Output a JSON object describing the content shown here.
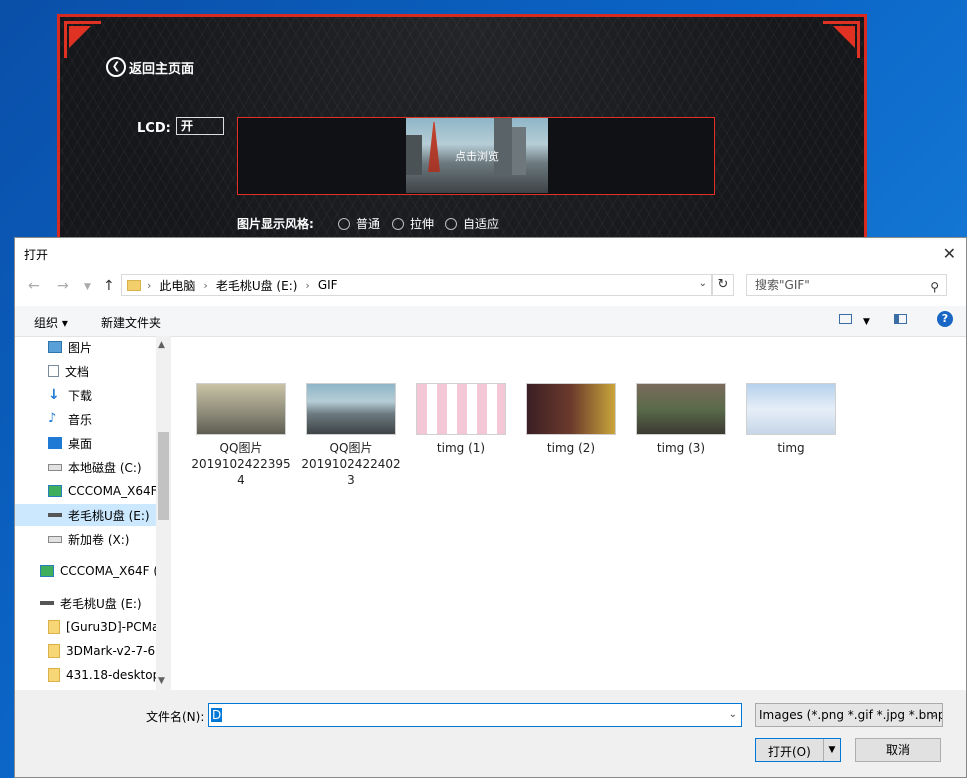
{
  "background_app": {
    "back_label": "返回主页面",
    "lcd_label": "LCD:",
    "lcd_value": "开",
    "preview_hint": "点击浏览",
    "style_label": "图片显示风格:",
    "style_options": [
      "普通",
      "拉伸",
      "自适应"
    ]
  },
  "dialog": {
    "title": "打开",
    "address": [
      "此电脑",
      "老毛桃U盘 (E:)",
      "GIF"
    ],
    "search_placeholder": "搜索\"GIF\"",
    "toolbar": {
      "organize": "组织 ▾",
      "new_folder": "新建文件夹"
    },
    "sidebar": [
      {
        "label": "图片",
        "icon": "pictures-icon"
      },
      {
        "label": "文档",
        "icon": "documents-icon"
      },
      {
        "label": "下载",
        "icon": "downloads-icon"
      },
      {
        "label": "音乐",
        "icon": "music-icon"
      },
      {
        "label": "桌面",
        "icon": "desktop-icon"
      },
      {
        "label": "本地磁盘 (C:)",
        "icon": "drive-icon"
      },
      {
        "label": "CCCOMA_X64F",
        "icon": "dvd-icon"
      },
      {
        "label": "老毛桃U盘 (E:)",
        "icon": "usb-drive-icon",
        "selected": true
      },
      {
        "label": "新加卷 (X:)",
        "icon": "drive-icon"
      },
      {
        "label": "CCCOMA_X64F (",
        "icon": "dvd-icon"
      },
      {
        "label": "老毛桃U盘 (E:)",
        "icon": "usb-drive-icon"
      },
      {
        "label": "[Guru3D]-PCMa",
        "icon": "folder-icon"
      },
      {
        "label": "3DMark-v2-7-6",
        "icon": "folder-icon"
      },
      {
        "label": "431.18-desktop",
        "icon": "folder-icon"
      }
    ],
    "files": [
      {
        "name": "QQ图片20191024223954",
        "line1": "QQ图片",
        "line2": "2019102422395",
        "line3": "4"
      },
      {
        "name": "QQ图片20191024224023",
        "line1": "QQ图片",
        "line2": "2019102422402",
        "line3": "3"
      },
      {
        "name": "timg (1)",
        "line1": "timg (1)",
        "line2": "",
        "line3": ""
      },
      {
        "name": "timg (2)",
        "line1": "timg (2)",
        "line2": "",
        "line3": ""
      },
      {
        "name": "timg (3)",
        "line1": "timg (3)",
        "line2": "",
        "line3": ""
      },
      {
        "name": "timg",
        "line1": "timg",
        "line2": "",
        "line3": ""
      }
    ],
    "filename_label": "文件名(N):",
    "filename_value": "D",
    "filetype": "Images (*.png *.gif *.jpg *.bmp)",
    "open_label": "打开(O)",
    "cancel_label": "取消"
  },
  "colors": {
    "accent_red": "#e03222",
    "selection_blue": "#0078d7",
    "sidebar_selected": "#cce8ff"
  }
}
